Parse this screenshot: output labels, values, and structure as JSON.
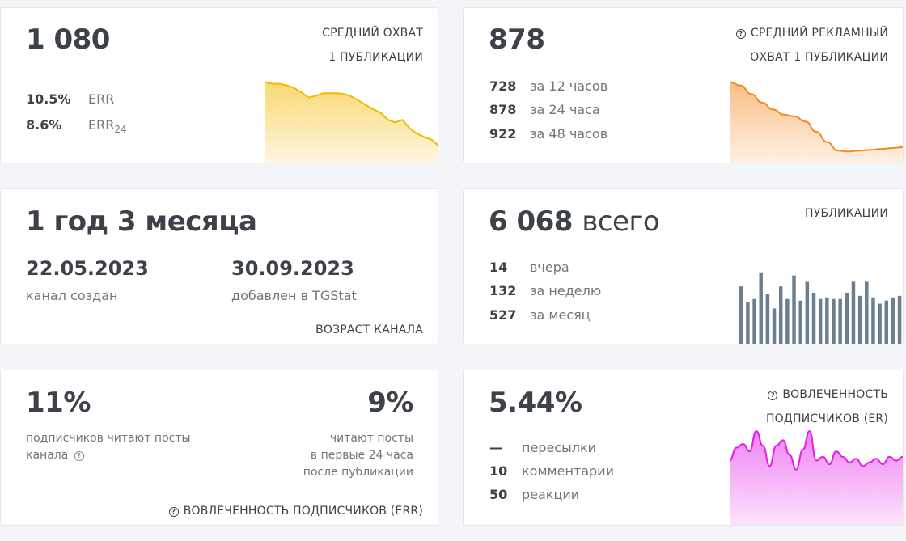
{
  "reach": {
    "value": "1 080",
    "caption_line1": "СРЕДНИЙ ОХВАТ",
    "caption_line2": "1 ПУБЛИКАЦИИ",
    "err_value": "10.5%",
    "err_label": "ERR",
    "err24_value": "8.6%",
    "err24_label": "ERR",
    "err24_sub": "24",
    "color": "#f5b800",
    "sparkline": [
      92,
      90,
      90,
      88,
      85,
      80,
      74,
      76,
      79,
      79,
      79,
      78,
      75,
      70,
      65,
      60,
      56,
      48,
      45,
      48,
      38,
      32,
      28,
      25,
      18
    ]
  },
  "ad_reach": {
    "value": "878",
    "caption_line1": "СРЕДНИЙ РЕКЛАМНЫЙ",
    "caption_line2": "ОХВАТ 1 ПУБЛИКАЦИИ",
    "help_icon": "question-circle-icon",
    "rows": [
      {
        "value": "728",
        "label": "за 12 часов"
      },
      {
        "value": "878",
        "label": "за 24 часа"
      },
      {
        "value": "922",
        "label": "за 48 часов"
      }
    ],
    "color": "#f5891f",
    "sparkline": [
      92,
      88,
      78,
      68,
      60,
      54,
      52,
      46,
      34,
      22,
      12,
      11,
      12,
      13,
      14,
      15,
      16
    ]
  },
  "age": {
    "value": "1 год 3 месяца",
    "created_date": "22.05.2023",
    "created_label": "канал создан",
    "added_date": "30.09.2023",
    "added_label": "добавлен в TGStat",
    "caption": "ВОЗРАСТ КАНАЛА"
  },
  "publications": {
    "value": "6 068",
    "value_suffix": "всего",
    "caption": "ПУБЛИКАЦИИ",
    "rows": [
      {
        "value": "14",
        "label": "вчера"
      },
      {
        "value": "132",
        "label": "за неделю"
      },
      {
        "value": "527",
        "label": "за месяц"
      }
    ],
    "color": "#6c7f91",
    "bars": [
      74,
      54,
      58,
      92,
      64,
      46,
      74,
      58,
      88,
      56,
      80,
      66,
      58,
      60,
      58,
      58,
      66,
      80,
      62,
      80,
      60,
      52,
      56,
      60,
      62
    ]
  },
  "err_card": {
    "left_value": "11%",
    "left_text_line1": "подписчиков читают посты",
    "left_text_line2": "канала",
    "right_value": "9%",
    "right_text_line1": "читают посты",
    "right_text_line2": "в первые 24 часа",
    "right_text_line3": "после публикации",
    "caption": "ВОВЛЕЧЕННОСТЬ ПОДПИСЧИКОВ (ERR)",
    "help_icon": "question-circle-icon"
  },
  "er_card": {
    "value": "5.44%",
    "caption_line1": "ВОВЛЕЧЕННОСТЬ",
    "caption_line2": "ПОДПИСЧИКОВ (ER)",
    "help_icon": "question-circle-icon",
    "rows": [
      {
        "value": "—",
        "label": "пересылки"
      },
      {
        "value": "10",
        "label": "комментарии"
      },
      {
        "value": "50",
        "label": "реакции"
      }
    ],
    "color": "#e21ee8",
    "sparkline": [
      68,
      82,
      86,
      78,
      100,
      84,
      62,
      84,
      90,
      74,
      58,
      80,
      100,
      68,
      72,
      64,
      78,
      72,
      66,
      70,
      62,
      66,
      70,
      64,
      72,
      68,
      72
    ]
  }
}
